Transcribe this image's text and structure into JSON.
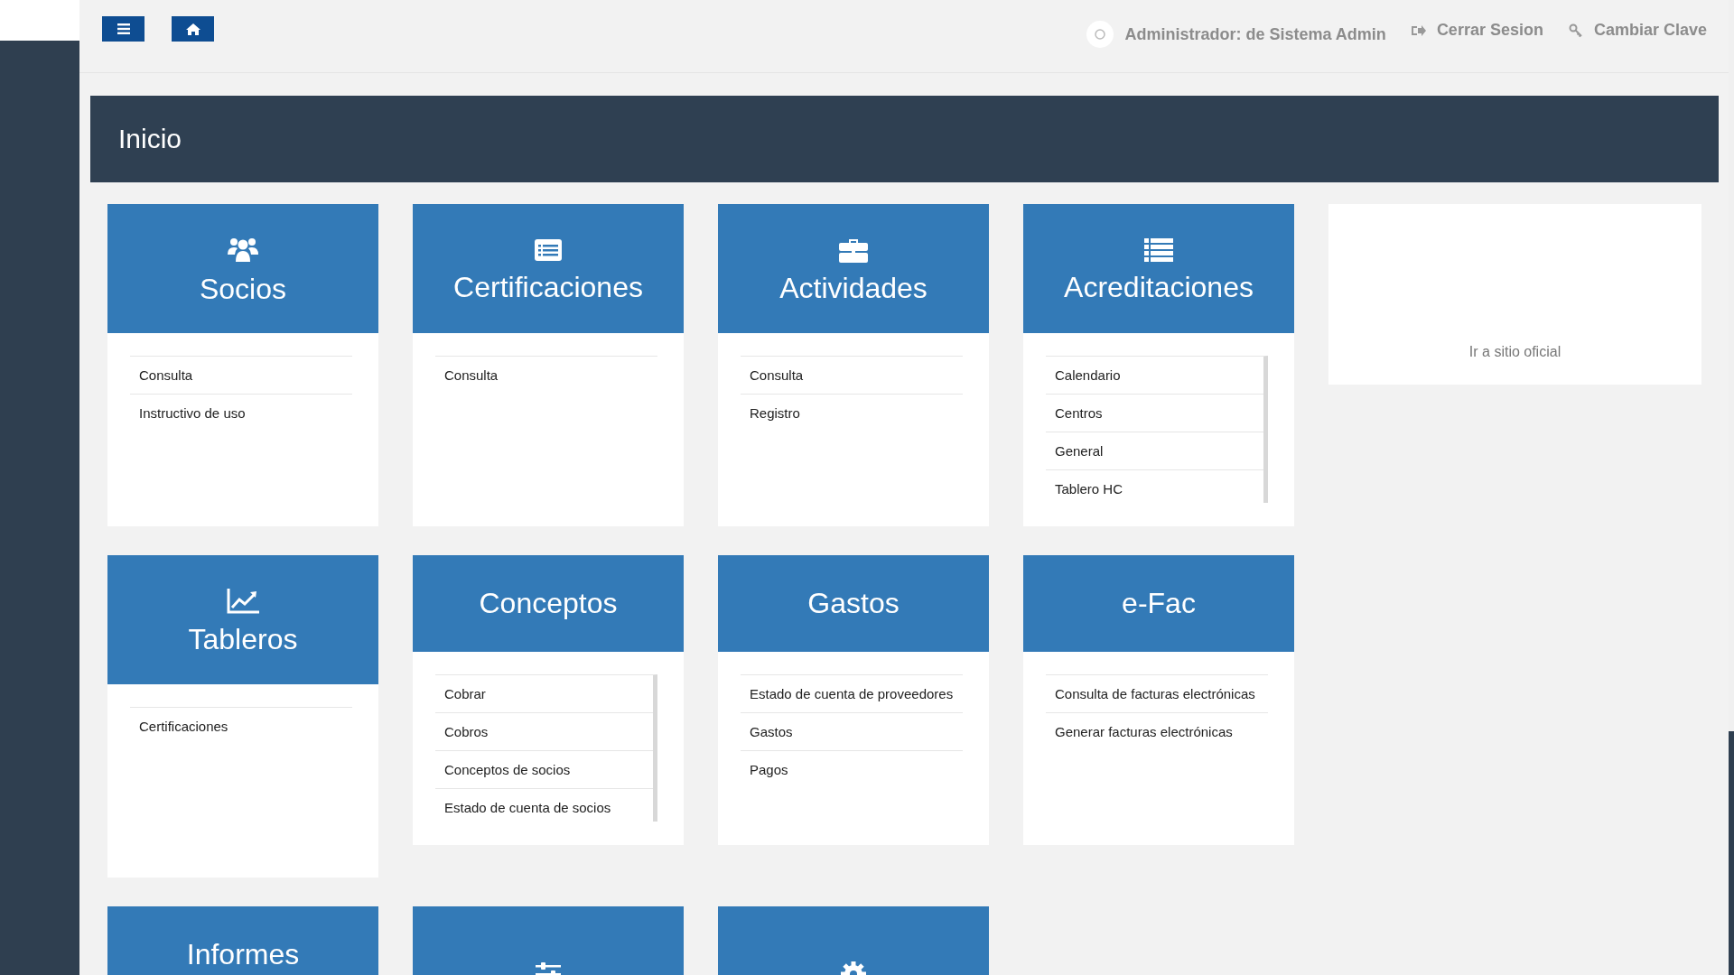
{
  "topbar": {
    "user": "Administrador: de Sistema Admin",
    "logout": "Cerrar Sesion",
    "change_password": "Cambiar Clave"
  },
  "page_title": "Inicio",
  "cards": [
    {
      "kind": "users",
      "title": "Socios",
      "links": [
        "Consulta",
        "Instructivo de uso"
      ]
    },
    {
      "kind": "list-card",
      "title": "Certificaciones",
      "links": [
        "Consulta"
      ]
    },
    {
      "kind": "briefcase",
      "title": "Actividades",
      "links": [
        "Consulta",
        "Registro"
      ]
    },
    {
      "kind": "list",
      "title": "Acreditaciones",
      "links": [
        "Calendario",
        "Centros",
        "General",
        "Tablero HC"
      ]
    },
    {
      "kind": "chart",
      "title": "Tableros",
      "links": [
        "Certificaciones"
      ]
    },
    {
      "kind": "plain",
      "title": "Conceptos",
      "links": [
        "Cobrar",
        "Cobros",
        "Conceptos de socios",
        "Estado de cuenta de socios"
      ]
    },
    {
      "kind": "plain",
      "title": "Gastos",
      "links": [
        "Estado de cuenta de proveedores",
        "Gastos",
        "Pagos"
      ]
    },
    {
      "kind": "plain",
      "title": "e-Fac",
      "links": [
        "Consulta de facturas electrónicas",
        "Generar facturas electrónicas"
      ]
    },
    {
      "kind": "plain",
      "title": "Informes"
    },
    {
      "kind": "sliders"
    },
    {
      "kind": "gear"
    }
  ],
  "official_link": "Ir a sitio oficial"
}
